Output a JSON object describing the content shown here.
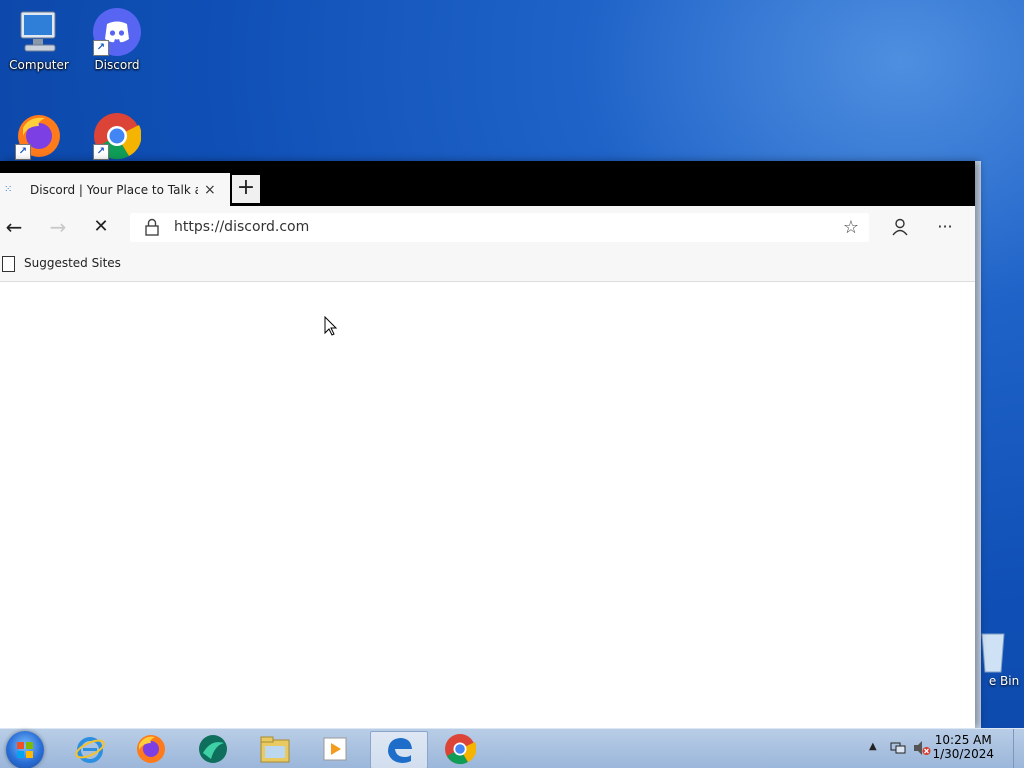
{
  "desktop": {
    "icons": [
      {
        "label": "Computer"
      },
      {
        "label": "Discord"
      },
      {
        "label": ""
      },
      {
        "label": ""
      }
    ],
    "recycle_bin_partial_label": "e Bin"
  },
  "browser": {
    "tab": {
      "title": "Discord | Your Place to Talk and",
      "close": "×"
    },
    "new_tab": "+",
    "address": {
      "url": "https://discord.com"
    },
    "bookmarks": {
      "suggested": "Suggested Sites"
    }
  },
  "taskbar": {
    "time": "10:25 AM",
    "date": "1/30/2024",
    "items": [
      "internet-explorer",
      "firefox",
      "app-teal",
      "file-explorer",
      "media-player",
      "edge",
      "chrome"
    ]
  },
  "colors": {
    "desktop_bg": "#1f63c8",
    "taskbar_bg": "#a9c2e2",
    "discord": "#5865f2"
  }
}
